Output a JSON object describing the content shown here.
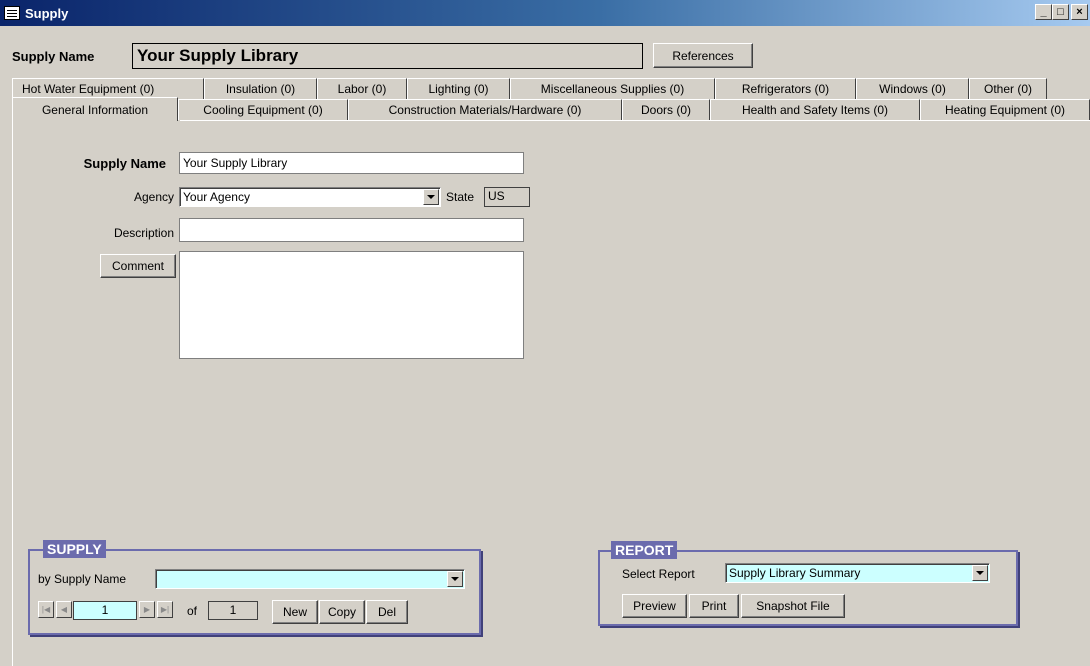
{
  "window": {
    "title": "Supply",
    "minimize": "_",
    "maximize": "□",
    "close": "×"
  },
  "header": {
    "supply_name_label": "Supply Name",
    "supply_name_value": "Your Supply Library",
    "references_button": "References"
  },
  "tabs_back": [
    "Hot Water Equipment (0)",
    "Insulation (0)",
    "Labor (0)",
    "Lighting (0)",
    "Miscellaneous Supplies (0)",
    "Refrigerators (0)",
    "Windows (0)",
    "Other (0)"
  ],
  "tabs_front": [
    "General Information",
    "Cooling Equipment (0)",
    "Construction Materials/Hardware (0)",
    "Doors (0)",
    "Health and Safety Items (0)",
    "Heating Equipment (0)"
  ],
  "form": {
    "supply_name_label": "Supply Name",
    "supply_name_value": "Your Supply Library",
    "agency_label": "Agency",
    "agency_value": "Your Agency",
    "state_label": "State",
    "state_value": "US",
    "description_label": "Description",
    "description_value": "",
    "comment_button": "Comment",
    "comment_value": ""
  },
  "supply_group": {
    "title": "SUPPLY",
    "by_label": "by Supply Name",
    "by_value": "",
    "record_current": "1",
    "of_label": "of",
    "record_total": "1",
    "new_button": "New",
    "copy_button": "Copy",
    "del_button": "Del"
  },
  "report_group": {
    "title": "REPORT",
    "select_label": "Select Report",
    "select_value": "Supply Library Summary",
    "preview_button": "Preview",
    "print_button": "Print",
    "snapshot_button": "Snapshot File"
  }
}
